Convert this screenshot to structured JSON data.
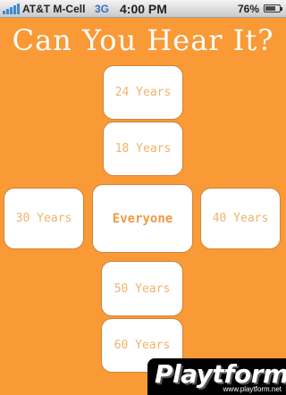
{
  "status_bar": {
    "carrier": "AT&T M-Cell",
    "network": "3G",
    "time": "4:00 PM",
    "battery": "76%",
    "battery_level": 0.76
  },
  "title": "Can You Hear It?",
  "buttons": {
    "y24": "24 Years",
    "y18": "18 Years",
    "y30": "30 Years",
    "everyone": "Everyone",
    "y40": "40 Years",
    "y50": "50 Years",
    "y60": "60 Years"
  },
  "watermark": {
    "logo": "Playtform",
    "url": "www.playtform.net"
  },
  "colors": {
    "background": "#f99a36",
    "tile": "#ffffff",
    "tile_text": "#f0b36e"
  }
}
